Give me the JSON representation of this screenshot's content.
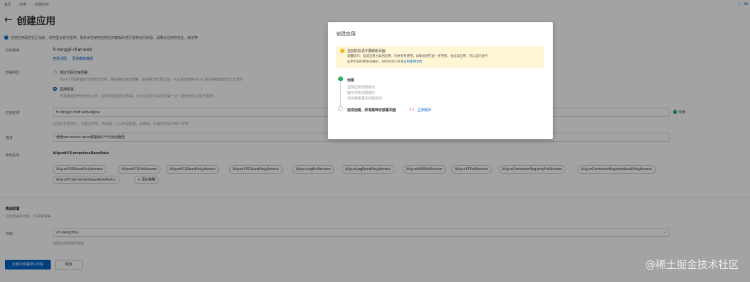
{
  "nav": {
    "home": "首页",
    "apps": "应用",
    "create": "创建应用",
    "right_label": "Ne"
  },
  "page_title": "创建应用",
  "notice": "当前应用源自社区贡献，非阿里云官方提供，服务会在使用当前应用模板时进行授权访问资源，请确认应用的安全、稳定等",
  "template": {
    "label": "应用模板",
    "value": "fc-tongyi-chat-web",
    "link1": "查看详情",
    "link2": "更多模板模版"
  },
  "deploy_type": {
    "label": "部署类型",
    "option1": "通过代码仓库部署",
    "option1_desc": "Push 代码到指定仓库的分支时，将会触发自动部署，后续更改代码仓库，可以通过使用 Push 触发持续集成的方式发布",
    "option2": "直接部署",
    "option2_desc": "不需要借助代码仓库上传，应用将自动执行部署，也可以自定义执行部署一次（后续也可以自己更新）"
  },
  "app_name": {
    "label": "应用名称",
    "value": "fc-tongyi-chat-web-eigna",
    "status": "可用",
    "hint": "必须以字母开头，不超过字母，中划线（_)以字母结尾，请使用，长度在不长于64个字符"
  },
  "description": {
    "label": "描述",
    "value": "使用serverless devs部署通义千问对话服务"
  },
  "role": {
    "label": "角色名称",
    "value": "AliyunFCServerlessDevsRole",
    "tags": [
      "AliyunOSSReadOnlyAccess",
      "AliyunECSFullAccess",
      "AliyunECSReadOnlyAccess",
      "AliyunVPCReadOnlyAccess",
      "AliyunLogFullAccess",
      "AliyunLogReadOnlyAccess",
      "AliyunNASFullAccess",
      "AliyunFCFullAccess",
      "AliyunContainerRegistryFullAccess",
      "AliyunContainerRegistryReadOnlyAccess",
      "AliyunFCServerlessDevsRolePolicy"
    ],
    "add_policy": "+ 添加策略"
  },
  "advanced": {
    "title": "高级配置",
    "subtitle": "应用部署的地域、环境变量等",
    "region_label": "地域",
    "region_value": "cn-hangzhou",
    "region_hint": "选择应用部署的地域"
  },
  "buttons": {
    "create": "创建并部署默认环境",
    "cancel": "取消"
  },
  "modal": {
    "title": "创建应用",
    "warn_title": "当前阶段请不要刷新页面",
    "warn_line1": "温馨提示：当前应用为案例应用，仅供参考使用，如果您想在进一步完善、优化该应用，可以自行进行",
    "warn_line2_prefix": "应用代码的更新与维护，同时也可以参考",
    "warn_link": "应用使用文档",
    "step1_title": "创建",
    "step1_items": [
      "当前应用创建成功",
      "提示信息创建成功",
      "当前部署基本创建成功"
    ],
    "step2_title": "完成创建，即将跳转去部署页面",
    "step2_countdown": "2 s",
    "step2_link": "立即跳转"
  },
  "watermark": "@稀土掘金技术社区",
  "colors": {
    "primary": "#0064c8",
    "success": "#22a744",
    "warning_bg": "#fff6d6"
  }
}
